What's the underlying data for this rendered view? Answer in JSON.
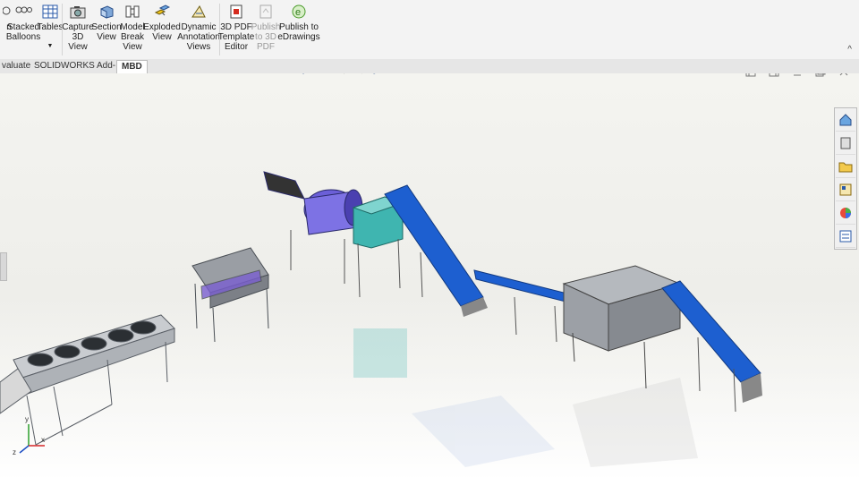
{
  "ribbon": {
    "buttons": [
      {
        "label": "n",
        "icon": "balloon-icon"
      },
      {
        "label": "Stacked\nBalloons",
        "icon": "stacked-balloons-icon"
      },
      {
        "label": "Tables",
        "icon": "table-icon"
      },
      {
        "label": "Capture\n3D\nView",
        "icon": "capture-3d-view-icon"
      },
      {
        "label": "Section\nView",
        "icon": "section-view-icon"
      },
      {
        "label": "Model\nBreak\nView",
        "icon": "model-break-view-icon"
      },
      {
        "label": "Exploded\nView",
        "icon": "exploded-view-icon"
      },
      {
        "label": "Dynamic\nAnnotation\nViews",
        "icon": "dynamic-annotation-icon"
      },
      {
        "label": "3D PDF\nTemplate\nEditor",
        "icon": "pdf-template-icon"
      },
      {
        "label": "Publish\nto 3D\nPDF",
        "icon": "publish-3d-pdf-icon",
        "disabled": true
      },
      {
        "label": "Publish to\neDrawings",
        "icon": "edrawings-icon"
      }
    ],
    "collapse_glyph": "^"
  },
  "tabs": [
    {
      "label": "valuate",
      "active": false
    },
    {
      "label": "SOLIDWORKS Add-Ins",
      "active": false
    },
    {
      "label": "MBD",
      "active": true
    }
  ],
  "heads_up_toolbar": [
    "view-orientation-icon",
    "zoom-to-fit-icon",
    "zoom-area-icon",
    "previous-view-icon",
    "section-view-icon",
    "display-style-icon",
    "hide-show-icon",
    "edit-appearance-icon",
    "apply-scene-icon",
    "view-settings-icon"
  ],
  "window_controls": [
    "tile-left-icon",
    "tile-right-icon",
    "restore-icon",
    "maximize-icon",
    "close-icon"
  ],
  "task_pane": [
    "home-icon",
    "design-library-icon",
    "file-explorer-icon",
    "view-palette-icon",
    "appearances-icon",
    "custom-properties-icon"
  ],
  "triad_axes": {
    "x": "x",
    "y": "y",
    "z": "z"
  },
  "colors": {
    "accent_blue": "#1d5fd0",
    "teal": "#3fb5b0",
    "frame": "#9a9fa5"
  }
}
